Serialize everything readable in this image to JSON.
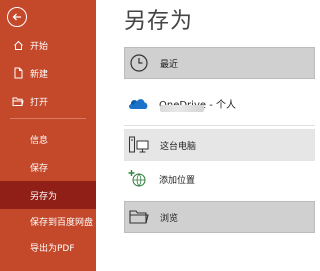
{
  "sidebar": {
    "items": [
      {
        "label": "开始",
        "icon": "home-icon"
      },
      {
        "label": "新建",
        "icon": "new-file-icon"
      },
      {
        "label": "打开",
        "icon": "open-folder-icon"
      },
      {
        "label": "信息"
      },
      {
        "label": "保存"
      },
      {
        "label": "另存为",
        "selected": true
      },
      {
        "label": "保存到百度网盘"
      },
      {
        "label": "导出为PDF"
      }
    ]
  },
  "main": {
    "title": "另存为",
    "locations": [
      {
        "label": "最近",
        "icon": "clock-icon"
      },
      {
        "label": "OneDrive - 个人",
        "icon": "onedrive-cloud-icon"
      },
      {
        "label": "这台电脑",
        "icon": "computer-icon"
      },
      {
        "label": "添加位置",
        "icon": "add-location-icon"
      },
      {
        "label": "浏览",
        "icon": "folder-icon"
      }
    ]
  },
  "colors": {
    "sidebar": "#c4482a",
    "selected_nav": "#8f1f17",
    "selected_location": "#d0d0d0"
  }
}
